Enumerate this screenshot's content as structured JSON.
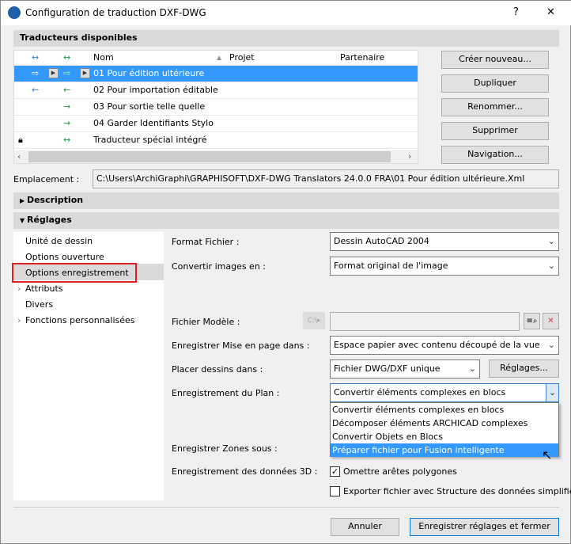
{
  "window": {
    "title": "Configuration de traduction DXF-DWG",
    "help": "?",
    "close": "✕"
  },
  "translators": {
    "header": "Traducteurs disponibles",
    "columns": {
      "c1": "↔",
      "c2": "↔",
      "name": "Nom",
      "project": "Projet",
      "partner": "Partenaire"
    },
    "rows": [
      {
        "a": "⇨",
        "b": "⇨",
        "name": "01 Pour édition ultérieure"
      },
      {
        "a": "←",
        "b": "←",
        "name": "02 Pour importation éditable"
      },
      {
        "a": "",
        "b": "→",
        "name": "03 Pour sortie telle quelle"
      },
      {
        "a": "",
        "b": "→",
        "name": "04 Garder Identifiants Stylo"
      },
      {
        "a": "",
        "b": "↔",
        "name": "Traducteur spécial intégré"
      }
    ],
    "buttons": [
      "Créer nouveau...",
      "Dupliquer",
      "Renommer...",
      "Supprimer",
      "Navigation..."
    ]
  },
  "location": {
    "label": "Emplacement :",
    "value": "C:\\Users\\ArchiGraphi\\GRAPHISOFT\\DXF-DWG Translators 24.0.0 FRA\\01 Pour édition ultérieure.Xml"
  },
  "sections": {
    "description": "Description",
    "settings": "Réglages"
  },
  "nav": [
    "Unité de dessin",
    "Options ouverture",
    "Options enregistrement",
    "Attributs",
    "Divers",
    "Fonctions personnalisées"
  ],
  "form": {
    "format_label": "Format Fichier :",
    "format_value": "Dessin AutoCAD 2004",
    "images_label": "Convertir images en :",
    "images_value": "Format original de l'image",
    "template_label": "Fichier Modèle :",
    "template_value": "",
    "layout_label": "Enregistrer Mise en page dans :",
    "layout_value": "Espace papier avec contenu découpé de la vue",
    "place_label": "Placer dessins dans :",
    "place_value": "Fichier DWG/DXF unique",
    "place_button": "Réglages...",
    "plan_label": "Enregistrement du Plan :",
    "plan_value": "Convertir éléments complexes en blocs",
    "plan_options": [
      "Convertir éléments complexes en blocs",
      "Décomposer éléments ARCHICAD complexes",
      "Convertir Objets en Blocs",
      "Préparer fichier pour Fusion intelligente"
    ],
    "zones_label": "Enregistrer Zones sous :",
    "data3d_label": "Enregistrement des données 3D :",
    "omit_edges": "Omettre arêtes polygones",
    "omit_checked": true,
    "simplified": "Exporter fichier avec Structure des données simplifiée",
    "simplified_checked": false
  },
  "footer": {
    "cancel": "Annuler",
    "save": "Enregistrer réglages et fermer"
  }
}
